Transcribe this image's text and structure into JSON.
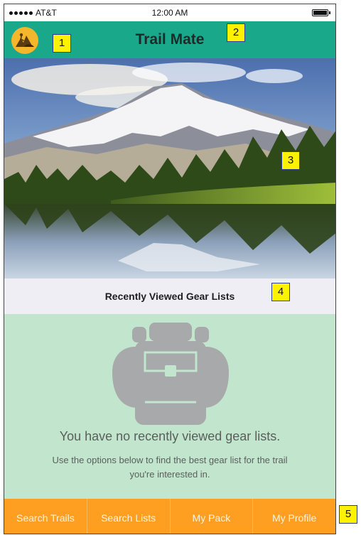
{
  "status_bar": {
    "carrier": "AT&T",
    "time": "12:00 AM"
  },
  "header": {
    "title": "Trail Mate",
    "logo_icon": "hiking-logo-icon"
  },
  "hero": {
    "description_icon": "mountain-lake-photo"
  },
  "section": {
    "title": "Recently Viewed Gear Lists"
  },
  "empty_state": {
    "icon": "backpack-icon",
    "title": "You have no recently viewed gear lists.",
    "subtitle": "Use the options below to find the best gear list for the trail you're interested in."
  },
  "tabs": [
    {
      "label": "Search Trails"
    },
    {
      "label": "Search Lists"
    },
    {
      "label": "My Pack"
    },
    {
      "label": "My Profile"
    }
  ],
  "annotations": [
    "1",
    "2",
    "3",
    "4",
    "5"
  ],
  "colors": {
    "header": "#1aa88b",
    "logo": "#f4b62b",
    "section_header": "#efeef5",
    "empty_bg": "#c2e5cd",
    "tab_bar": "#ff9f22",
    "badge": "#fff200"
  }
}
